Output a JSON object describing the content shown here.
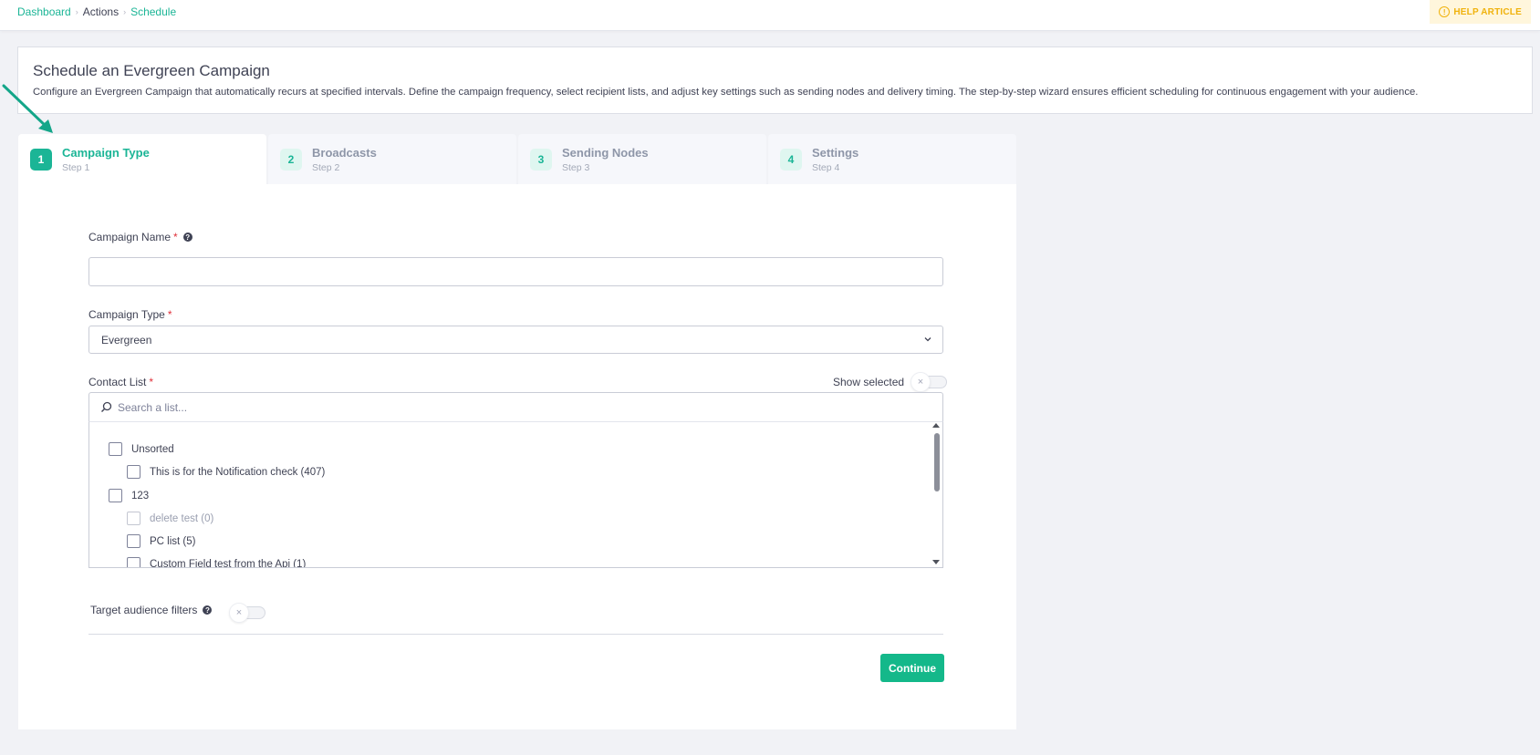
{
  "breadcrumb": [
    "Dashboard",
    "Actions",
    "Schedule"
  ],
  "help_article": "HELP ARTICLE",
  "page": {
    "title": "Schedule an Evergreen Campaign",
    "description": "Configure an Evergreen Campaign that automatically recurs at specified intervals. Define the campaign frequency, select recipient lists, and adjust key settings such as sending nodes and delivery timing. The step-by-step wizard ensures efficient scheduling for continuous engagement with your audience."
  },
  "steps": [
    {
      "num": "1",
      "title": "Campaign Type",
      "sub": "Step 1",
      "active": true
    },
    {
      "num": "2",
      "title": "Broadcasts",
      "sub": "Step 2",
      "active": false
    },
    {
      "num": "3",
      "title": "Sending Nodes",
      "sub": "Step 3",
      "active": false
    },
    {
      "num": "4",
      "title": "Settings",
      "sub": "Step 4",
      "active": false
    }
  ],
  "form": {
    "campaign_name": {
      "label": "Campaign Name",
      "required": "*",
      "value": ""
    },
    "campaign_type": {
      "label": "Campaign Type",
      "required": "*",
      "value": "Evergreen"
    },
    "contact_list": {
      "label": "Contact List",
      "required": "*",
      "show_selected": "Show selected",
      "show_selected_on": false,
      "search_placeholder": "Search a list...",
      "items": [
        {
          "label": "Unsorted",
          "level": 0,
          "disabled": false
        },
        {
          "label": "This is for the Notification check (407)",
          "level": 1,
          "disabled": false
        },
        {
          "label": "123",
          "level": 0,
          "disabled": false
        },
        {
          "label": "delete test (0)",
          "level": 1,
          "disabled": true
        },
        {
          "label": "PC list (5)",
          "level": 1,
          "disabled": false
        },
        {
          "label": "Custom Field test from the Api (1)",
          "level": 1,
          "disabled": false
        }
      ]
    },
    "target_filters": {
      "label": "Target audience filters",
      "on": false
    },
    "continue_label": "Continue"
  },
  "colors": {
    "accent": "#1bb596",
    "button": "#14b88a",
    "help": "#f0b20c",
    "required": "#e0303a"
  },
  "icons": [
    "help-circle-icon",
    "question-icon",
    "chevron-down-icon",
    "search-icon",
    "close-icon",
    "arrow-pointer-icon"
  ]
}
